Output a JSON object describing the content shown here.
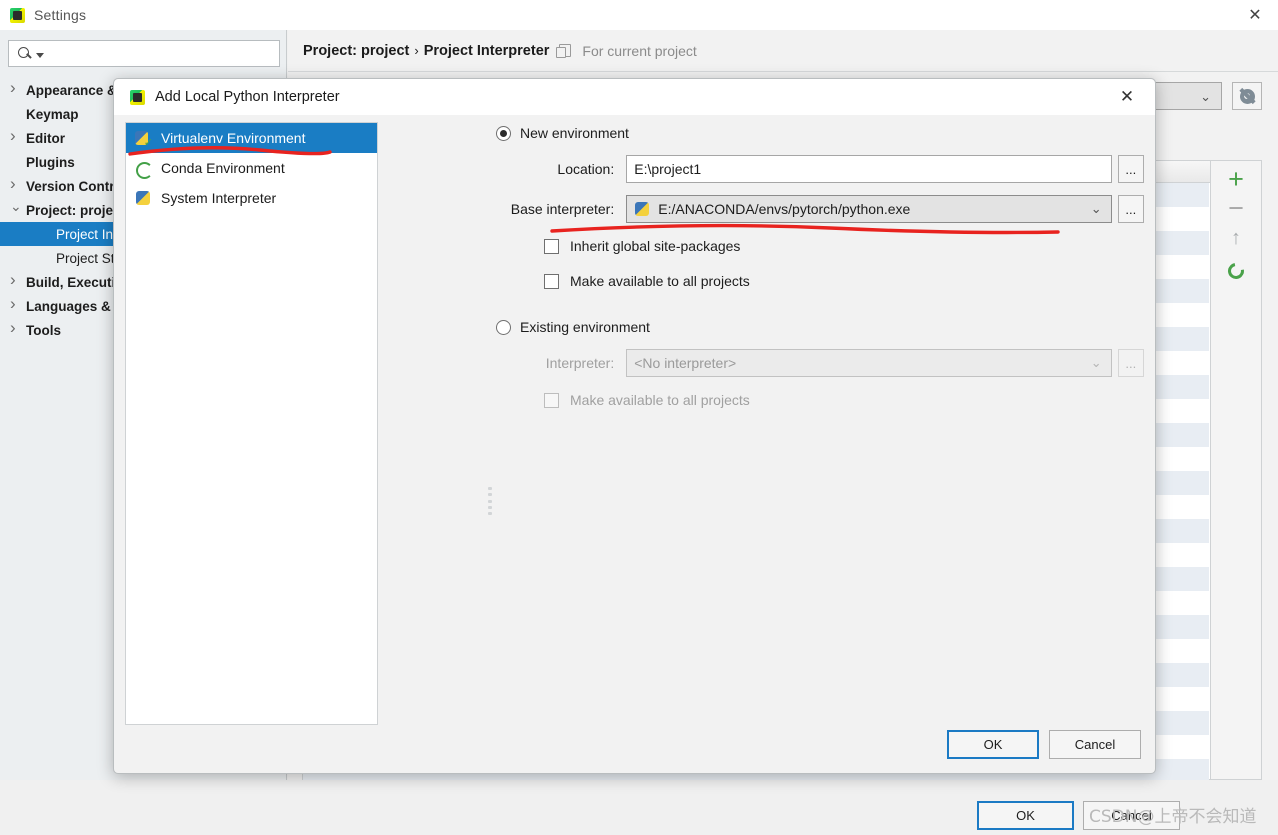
{
  "settings_window": {
    "title": "Settings",
    "close_icon": "close-icon",
    "search": {
      "value": "",
      "placeholder": ""
    },
    "nav_items": [
      {
        "label": "Appearance & Behavior",
        "expandable": true,
        "expanded": false,
        "bold": true,
        "indent": false,
        "selected": false
      },
      {
        "label": "Keymap",
        "expandable": false,
        "expanded": false,
        "bold": true,
        "indent": false,
        "selected": false
      },
      {
        "label": "Editor",
        "expandable": true,
        "expanded": false,
        "bold": true,
        "indent": false,
        "selected": false
      },
      {
        "label": "Plugins",
        "expandable": false,
        "expanded": false,
        "bold": true,
        "indent": false,
        "selected": false
      },
      {
        "label": "Version Control",
        "expandable": true,
        "expanded": false,
        "bold": true,
        "indent": false,
        "selected": false
      },
      {
        "label": "Project: project",
        "expandable": true,
        "expanded": true,
        "bold": true,
        "indent": false,
        "selected": false
      },
      {
        "label": "Project Interpreter",
        "expandable": false,
        "expanded": false,
        "bold": false,
        "indent": true,
        "selected": true
      },
      {
        "label": "Project Structure",
        "expandable": false,
        "expanded": false,
        "bold": false,
        "indent": true,
        "selected": false
      },
      {
        "label": "Build, Execution, Deployment",
        "expandable": true,
        "expanded": false,
        "bold": true,
        "indent": false,
        "selected": false
      },
      {
        "label": "Languages & Frameworks",
        "expandable": true,
        "expanded": false,
        "bold": true,
        "indent": false,
        "selected": false
      },
      {
        "label": "Tools",
        "expandable": true,
        "expanded": false,
        "bold": true,
        "indent": false,
        "selected": false
      }
    ],
    "help_label": "?",
    "breadcrumb": {
      "project": "Project: project",
      "separator": "›",
      "page": "Project Interpreter",
      "scope_note": "For current project"
    },
    "interpreter_combo_value": "",
    "gear_icon": "gear-icon",
    "package_toolbar": {
      "add": "+",
      "remove": "−",
      "upgrade": "↑",
      "refresh": "refresh-icon"
    },
    "ok_label": "OK",
    "cancel_label": "Cancel",
    "watermark": "CSDN@上帝不会知道"
  },
  "dialog": {
    "title": "Add Local Python Interpreter",
    "close_icon": "close-icon",
    "env_types": [
      {
        "label": "Virtualenv Environment",
        "icon": "virtualenv-icon",
        "selected": true
      },
      {
        "label": "Conda Environment",
        "icon": "conda-icon",
        "selected": false
      },
      {
        "label": "System Interpreter",
        "icon": "python-icon",
        "selected": false
      }
    ],
    "new_environment": {
      "radio_label": "New environment",
      "selected": true,
      "location_label": "Location:",
      "location_value": "E:\\project1",
      "location_browse": "...",
      "base_interpreter_label": "Base interpreter:",
      "base_interpreter_value": "E:/ANACONDA/envs/pytorch/python.exe",
      "base_interpreter_browse": "...",
      "inherit_label": "Inherit global site-packages",
      "inherit_checked": false,
      "make_available_label": "Make available to all projects",
      "make_available_checked": false
    },
    "existing_environment": {
      "radio_label": "Existing environment",
      "selected": false,
      "interpreter_label": "Interpreter:",
      "interpreter_value": "<No interpreter>",
      "interpreter_browse": "...",
      "make_available_label": "Make available to all projects",
      "make_available_checked": false
    },
    "ok_label": "OK",
    "cancel_label": "Cancel"
  },
  "colors": {
    "selection_blue": "#1a7dc4",
    "default_button_border": "#1b7ac4",
    "annotation_red": "#e8231f",
    "green_accent": "#4aa24a"
  }
}
